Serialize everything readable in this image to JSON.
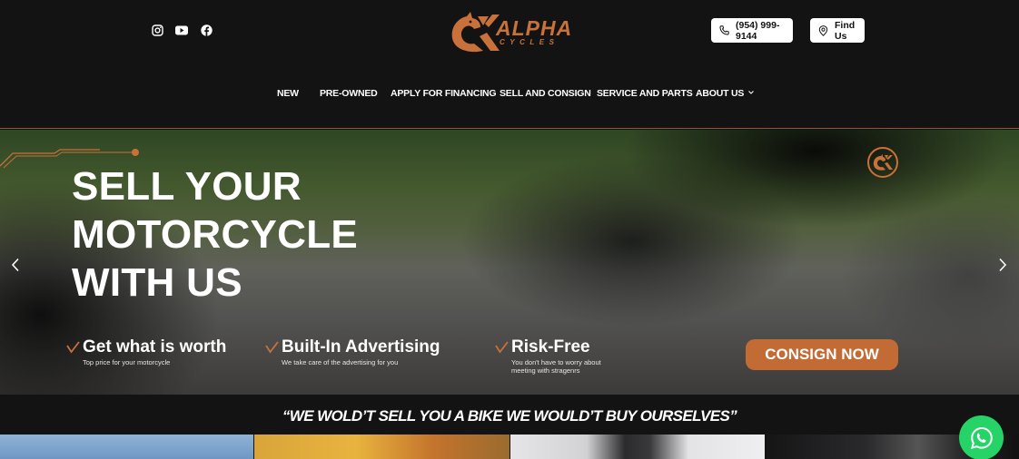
{
  "header": {
    "social": [
      "instagram-icon",
      "youtube-icon",
      "facebook-icon"
    ],
    "logo": {
      "text": "ALPHA",
      "subtext": "CYCLES"
    },
    "phone_label": "(954) 999-9144",
    "find_label": "Find Us",
    "nav": [
      {
        "label": "NEW"
      },
      {
        "label": "PRE-OWNED"
      },
      {
        "label": "APPLY FOR FINANCING"
      },
      {
        "label": "SELL AND CONSIGN"
      },
      {
        "label": "SERVICE AND PARTS"
      },
      {
        "label": "ABOUT US"
      }
    ]
  },
  "hero": {
    "headline": [
      "SELL YOUR",
      "MOTORCYCLE",
      "WITH US"
    ],
    "features": [
      {
        "title": "Get what is worth",
        "subtitle": "Top price for your motorcycle"
      },
      {
        "title": "Built-In Advertising",
        "subtitle": "We take care of the advertising for you"
      },
      {
        "title": "Risk-Free",
        "subtitle": "You don't have to worry about meeting with stragenrs"
      }
    ],
    "cta_label": "CONSIGN NOW"
  },
  "tagline": "“WE WOLD’T SELL YOU A BIKE WE WOULD’T BUY OURSELVES”",
  "colors": {
    "accent": "#c26b34",
    "background": "#141313",
    "whatsapp": "#25d366"
  }
}
